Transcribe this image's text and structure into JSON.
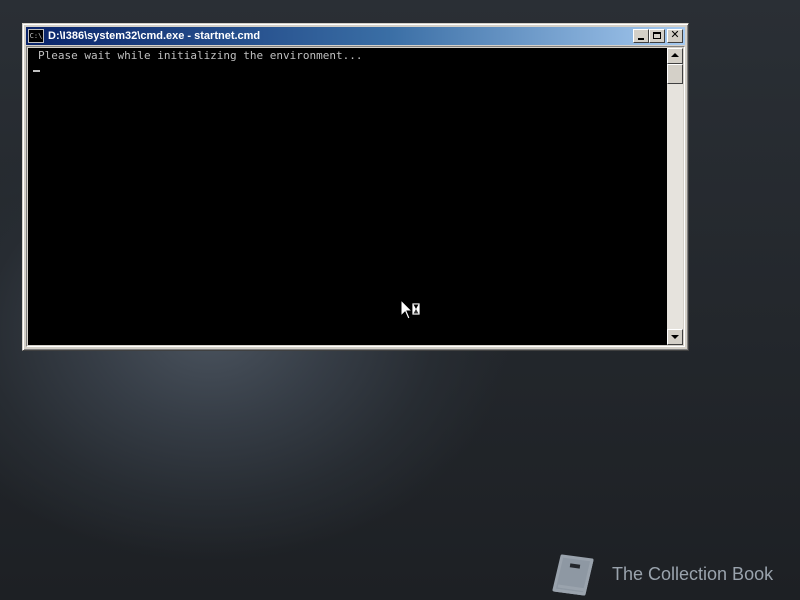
{
  "window": {
    "title": "D:\\I386\\system32\\cmd.exe - startnet.cmd",
    "icon": "cmd-icon",
    "icon_text": "C:\\",
    "buttons": {
      "minimize": "minimize-icon",
      "maximize": "maximize-icon",
      "close": "close-icon",
      "close_glyph": "✕"
    }
  },
  "console": {
    "lines": [
      "Please wait while initializing the environment..."
    ],
    "cursor": "_",
    "background": "#000000",
    "foreground": "#c0c0c0"
  },
  "scrollbar": {
    "up_icon": "scroll-up-arrow-icon",
    "down_icon": "scroll-down-arrow-icon"
  },
  "pointer": {
    "icon": "busy-pointer-icon"
  },
  "watermark": {
    "logo": "book-icon",
    "text": "The Collection Book"
  },
  "colors": {
    "titlebar_start": "#0a246a",
    "titlebar_end": "#a6caf0",
    "window_face": "#d4d0c8",
    "desktop": "#23272c"
  }
}
